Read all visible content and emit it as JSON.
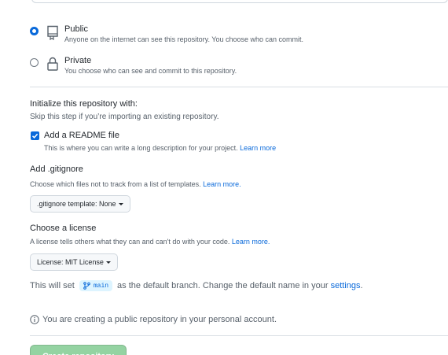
{
  "visibility": {
    "public": {
      "title": "Public",
      "description": "Anyone on the internet can see this repository. You choose who can commit.",
      "selected": true,
      "icon": "repo-icon"
    },
    "private": {
      "title": "Private",
      "description": "You choose who can see and commit to this repository.",
      "selected": false,
      "icon": "lock-icon"
    }
  },
  "initialize": {
    "title": "Initialize this repository with:",
    "description": "Skip this step if you’re importing an existing repository.",
    "readme": {
      "label": "Add a README file",
      "checked": true,
      "description": "This is where you can write a long description for your project.",
      "learn_more": "Learn more"
    }
  },
  "gitignore": {
    "title": "Add .gitignore",
    "description": "Choose which files not to track from a list of templates.",
    "learn_more": "Learn more.",
    "select_label": ".gitignore template: None"
  },
  "license": {
    "title": "Choose a license",
    "description": "A license tells others what they can and can't do with your code.",
    "learn_more": "Learn more.",
    "select_label": "License: MIT License"
  },
  "branch": {
    "prefix": "This will set",
    "name": "main",
    "middle": "as the default branch. Change the default name in your",
    "settings_link": "settings",
    "suffix": "."
  },
  "info": {
    "text": "You are creating a public repository in your personal account."
  },
  "create_button": {
    "label": "Create repository"
  },
  "colors": {
    "accent": "#0969da",
    "create_button_disabled": "#94d3a2",
    "muted_text": "#57606a"
  }
}
